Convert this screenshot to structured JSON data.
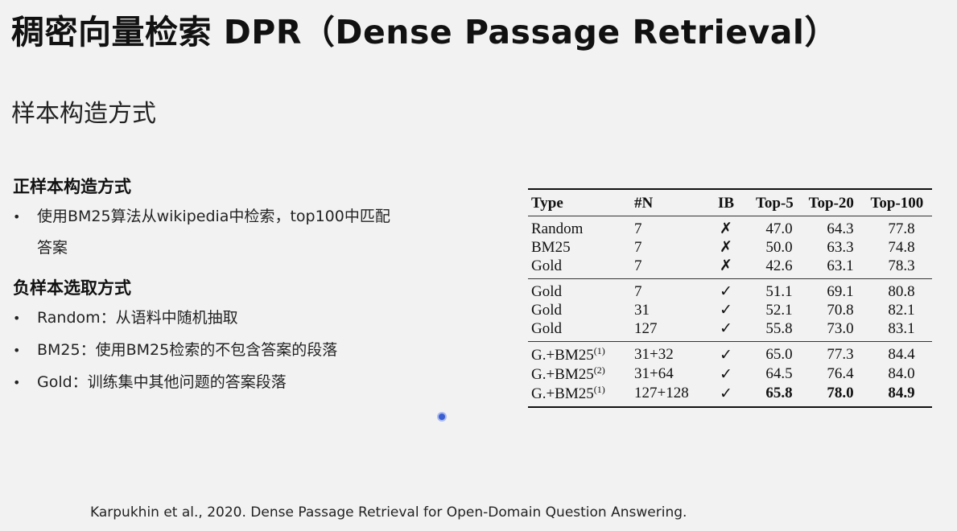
{
  "title": "稠密向量检索 DPR（Dense Passage Retrieval）",
  "subtitle": "样本构造方式",
  "positive": {
    "heading": "正样本构造方式",
    "bullets": [
      {
        "line1": "使用BM25算法从wikipedia中检索，top100中匹配",
        "line2": "答案"
      }
    ]
  },
  "negative": {
    "heading": "负样本选取方式",
    "bullets": [
      "Random：从语料中随机抽取",
      "BM25：使用BM25检索的不包含答案的段落",
      "Gold：训练集中其他问题的答案段落"
    ]
  },
  "bullet_glyph": "•",
  "table": {
    "headers": [
      "Type",
      "#N",
      "IB",
      "Top-5",
      "Top-20",
      "Top-100"
    ],
    "groups": [
      [
        {
          "type": "Random",
          "sup": "",
          "n": "7",
          "ib": "✗",
          "top5": "47.0",
          "top20": "64.3",
          "top100": "77.8"
        },
        {
          "type": "BM25",
          "sup": "",
          "n": "7",
          "ib": "✗",
          "top5": "50.0",
          "top20": "63.3",
          "top100": "74.8"
        },
        {
          "type": "Gold",
          "sup": "",
          "n": "7",
          "ib": "✗",
          "top5": "42.6",
          "top20": "63.1",
          "top100": "78.3"
        }
      ],
      [
        {
          "type": "Gold",
          "sup": "",
          "n": "7",
          "ib": "✓",
          "top5": "51.1",
          "top20": "69.1",
          "top100": "80.8"
        },
        {
          "type": "Gold",
          "sup": "",
          "n": "31",
          "ib": "✓",
          "top5": "52.1",
          "top20": "70.8",
          "top100": "82.1"
        },
        {
          "type": "Gold",
          "sup": "",
          "n": "127",
          "ib": "✓",
          "top5": "55.8",
          "top20": "73.0",
          "top100": "83.1"
        }
      ],
      [
        {
          "type": "G.+BM25",
          "sup": "(1)",
          "n": "31+32",
          "ib": "✓",
          "top5": "65.0",
          "top20": "77.3",
          "top100": "84.4"
        },
        {
          "type": "G.+BM25",
          "sup": "(2)",
          "n": "31+64",
          "ib": "✓",
          "top5": "64.5",
          "top20": "76.4",
          "top100": "84.0"
        },
        {
          "type": "G.+BM25",
          "sup": "(1)",
          "n": "127+128",
          "ib": "✓",
          "top5": "65.8",
          "top20": "78.0",
          "top100": "84.9",
          "bold": true
        }
      ]
    ]
  },
  "citation": "Karpukhin et al., 2020. Dense Passage Retrieval for Open-Domain Question Answering."
}
